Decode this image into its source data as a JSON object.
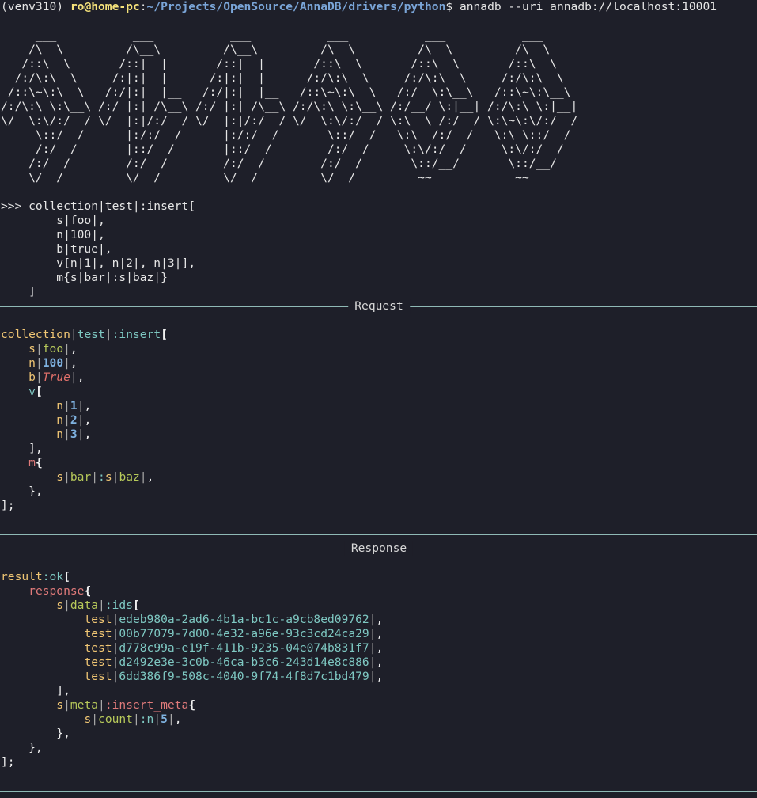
{
  "prompt": {
    "venv": "(venv310)",
    "user_host": "ro@home-pc",
    "colon": ":",
    "path": "~/Projects/OpenSource/AnnaDB/drivers/python",
    "dollar": "$",
    "command": "annadb --uri annadb://localhost:10001"
  },
  "banner_ascii": "     ___           ___           ___           ___           ___           ___     \n    /\\  \\         /\\__\\         /\\__\\         /\\  \\         /\\  \\         /\\  \\    \n   /::\\  \\       /::|  |       /::|  |       /::\\  \\       /::\\  \\       /::\\  \\   \n  /:/\\:\\  \\     /:|:|  |      /:|:|  |      /:/\\:\\  \\     /:/\\:\\  \\     /:/\\:\\  \\  \n /::\\~\\:\\  \\   /:/|:|  |__   /:/|:|  |__   /::\\~\\:\\  \\   /:/  \\:\\__\\   /::\\~\\:\\__\\ \n/:/\\:\\ \\:\\__\\ /:/ |:| /\\__\\ /:/ |:| /\\__\\ /:/\\:\\ \\:\\__\\ /:/__/ \\:|__| /:/\\:\\ \\:|__|\n\\/__\\:\\/:/  / \\/__|:|/:/  / \\/__|:|/:/  / \\/__\\:\\/:/  / \\:\\  \\ /:/  / \\:\\~\\:\\/:/  /\n     \\::/  /      |:/:/  /      |:/:/  /       \\::/  /   \\:\\  /:/  /   \\:\\ \\::/  / \n     /:/  /       |::/  /       |::/  /        /:/  /     \\:\\/:/  /     \\:\\/:/  /  \n    /:/  /        /:/  /        /:/  /        /:/  /       \\::/__/       \\::/__/   \n    \\/__/         \\/__/         \\/__/         \\/__/         ~~            ~~       ",
  "input": {
    "lines": [
      ">>> collection|test|:insert[",
      "        s|foo|,",
      "        n|100|,",
      "        b|true|,",
      "        v[n|1|, n|2|, n|3|],",
      "        m{s|bar|:s|baz|}",
      "    ]"
    ]
  },
  "sections": {
    "request_title": "Request",
    "response_title": "Response"
  },
  "request": {
    "collection": "collection",
    "test": "test",
    "insert": ":insert",
    "s": "s",
    "foo": "foo",
    "n": "n",
    "v100": "100",
    "b": "b",
    "true_val": "True",
    "v": "v",
    "one": "1",
    "two": "2",
    "three": "3",
    "m": "m",
    "bar": "bar",
    "baz": "baz"
  },
  "response": {
    "result": "result",
    "ok": ":ok",
    "response": "response",
    "s": "s",
    "data": "data",
    "ids": ":ids",
    "test": "test",
    "uuids": [
      "edeb980a-2ad6-4b1a-bc1c-a9cb8ed09762",
      "00b77079-7d00-4e32-a96e-93c3cd24ca29",
      "d778c99a-e19f-411b-9235-04e074b831f7",
      "d2492e3e-3c0b-46ca-b3c6-243d14e8c886",
      "6dd386f9-508c-4040-9f74-4f8d7c1bd479"
    ],
    "meta": "meta",
    "insert_meta": ":insert_meta",
    "count": "count",
    "n": ":n",
    "count_val": "5"
  },
  "colors": {
    "background": "#1e1f29",
    "rule": "#8fb9b5",
    "key": "#f0c674",
    "teal": "#7ec8c2",
    "green": "#b7c95a",
    "number": "#7fb2e0",
    "red": "#e07a7a"
  }
}
